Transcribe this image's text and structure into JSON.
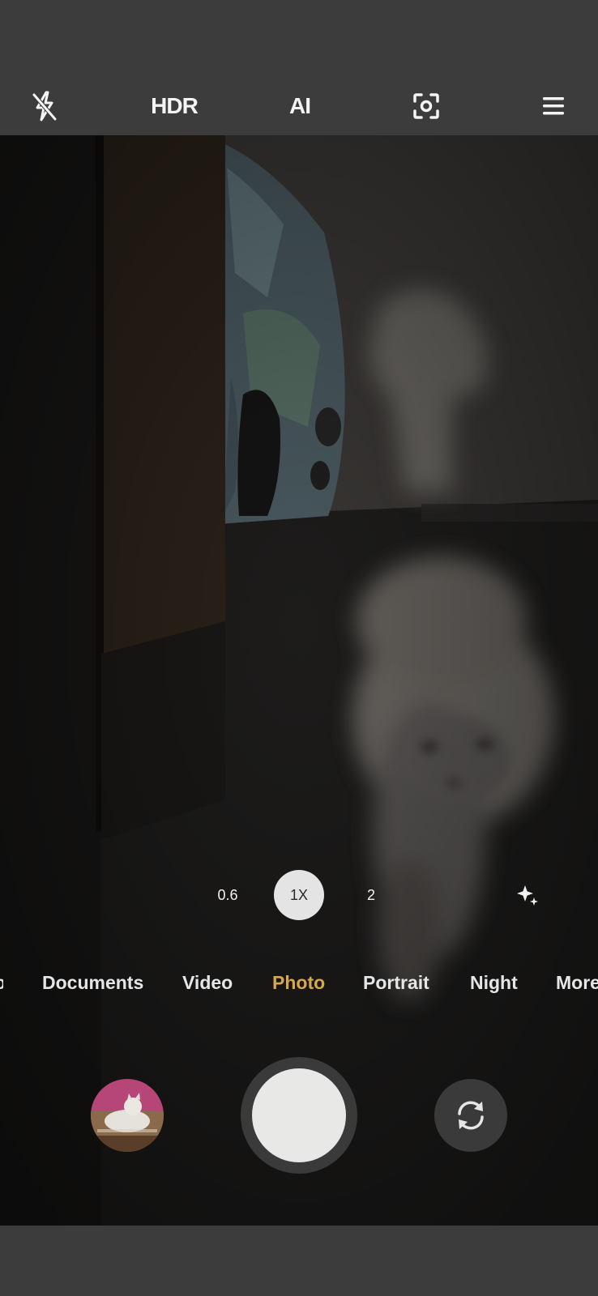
{
  "toolbar": {
    "flash_icon": "flash-off-icon",
    "hdr_label": "HDR",
    "ai_label": "AI",
    "focus_icon": "focus-frame-icon",
    "menu_icon": "menu-icon"
  },
  "zoom": {
    "options": [
      "0.6",
      "1X",
      "2"
    ],
    "selected": "1X",
    "effects_icon": "sparkle-icon"
  },
  "modes": {
    "items": [
      "Documents",
      "Video",
      "Photo",
      "Portrait",
      "Night",
      "More"
    ],
    "selected": "Photo",
    "accent_color": "#d7a74a"
  },
  "controls": {
    "gallery_icon": "gallery-thumbnail",
    "shutter_icon": "shutter-button",
    "switch_icon": "switch-camera-icon"
  }
}
